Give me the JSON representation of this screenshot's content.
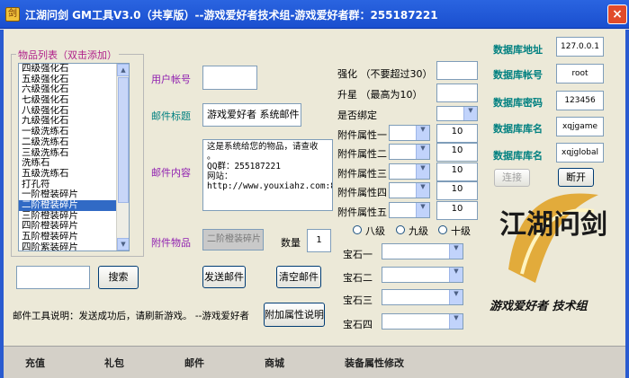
{
  "window": {
    "icon": "app-icon",
    "title": "江湖问剑 GM工具V3.0（共享版）--游戏爱好者技术组-游戏爱好者群：255187221",
    "close_label": "×"
  },
  "item_list": {
    "group_label": "物品列表（双击添加）",
    "items": [
      "四级强化石",
      "五级强化石",
      "六级强化石",
      "七级强化石",
      "八级强化石",
      "九级强化石",
      "一级洗练石",
      "二级洗练石",
      "三级洗练石",
      "洗练石",
      "五级洗练石",
      "打孔符",
      "一阶橙装碎片",
      "二阶橙装碎片",
      "三阶橙装碎片",
      "四阶橙装碎片",
      "五阶橙装碎片",
      "四阶紫装碎片",
      "一阶鞋子碎片"
    ],
    "selected_index": 13
  },
  "mail": {
    "account_label": "用户帐号",
    "account_value": "",
    "subject_label": "邮件标题",
    "subject_value": "游戏爱好者 系统邮件",
    "content_label": "邮件内容",
    "content_lines": [
      "这是系统给您的物品，请查收",
      "。",
      "QQ群：255187221",
      "网站：",
      "http://www.youxiahz.com:88"
    ],
    "attach_label": "附件物品",
    "attach_value": "二阶橙装碎片",
    "qty_label": "数量",
    "qty_value": "1"
  },
  "search": {
    "input_value": "",
    "button": "搜索"
  },
  "buttons": {
    "send": "发送邮件",
    "clear": "清空邮件",
    "attr_help": "附加属性说明",
    "connect": "连接",
    "disconnect": "断开"
  },
  "note": "邮件工具说明：发送成功后，请刷新游戏。 --游戏爱好者",
  "props": {
    "enhance_label": "强化 （不要超过30）",
    "enhance_value": "",
    "upgrade_label": "升星 （最高为10）",
    "upgrade_value": "",
    "bind_label": "是否绑定",
    "bind_value": "",
    "attrs": [
      {
        "label": "附件属性一",
        "value": "10"
      },
      {
        "label": "附件属性二",
        "value": "10"
      },
      {
        "label": "附件属性三",
        "value": "10"
      },
      {
        "label": "附件属性四",
        "value": "10"
      },
      {
        "label": "附件属性五",
        "value": "10"
      }
    ],
    "levels": [
      "八级",
      "九级",
      "十级"
    ],
    "gems": [
      {
        "label": "宝石一",
        "value": ""
      },
      {
        "label": "宝石二",
        "value": ""
      },
      {
        "label": "宝石三",
        "value": ""
      },
      {
        "label": "宝石四",
        "value": ""
      }
    ]
  },
  "db": {
    "addr_label": "数据库地址",
    "addr_value": "127.0.0.1",
    "user_label": "数据库帐号",
    "user_value": "root",
    "pwd_label": "数据库密码",
    "pwd_value": "123456",
    "name1_label": "数据库库名",
    "name1_value": "xqjgame",
    "name2_label": "数据库库名",
    "name2_value": "xqjglobal"
  },
  "branding": {
    "logo_text": "江湖问剑",
    "slogan": "游戏爱好者 技术组"
  },
  "status_bar": [
    "充值",
    "礼包",
    "邮件",
    "商城",
    "装备属性修改"
  ],
  "colors": {
    "title_bar": "#2a64e0",
    "label_purple": "#9020b0",
    "label_teal": "#008080",
    "selection": "#316ac5"
  }
}
